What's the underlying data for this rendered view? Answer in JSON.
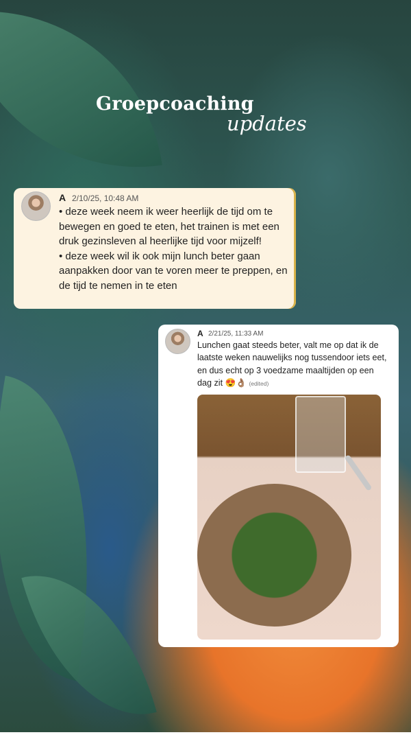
{
  "header": {
    "title": "Groepcoaching",
    "subtitle": "updates"
  },
  "messages": [
    {
      "user": "A",
      "timestamp": "2/10/25, 10:48 AM",
      "lines": [
        "• deze week neem ik weer heerlijk de tijd om te bewegen en goed te eten, het trainen is met een druk gezinsleven al heerlijke tijd voor mijzelf!",
        "• deze week wil ik ook mijn lunch beter gaan aanpakken door van te voren meer te preppen, en de tijd te nemen in te eten"
      ]
    },
    {
      "user": "A",
      "timestamp": "2/21/25, 11:33 AM",
      "text": "Lunchen gaat steeds beter, valt me op dat ik de laatste weken nauwelijks nog tussendoor iets eet, en dus echt op 3 voedzame maaltijden op een dag zit 😍👌🏽",
      "edited": "(edited)"
    }
  ],
  "colors": {
    "card1_bg": "#fdf3e1",
    "card2_bg": "#ffffff",
    "accent_orange": "#f08a3a"
  }
}
